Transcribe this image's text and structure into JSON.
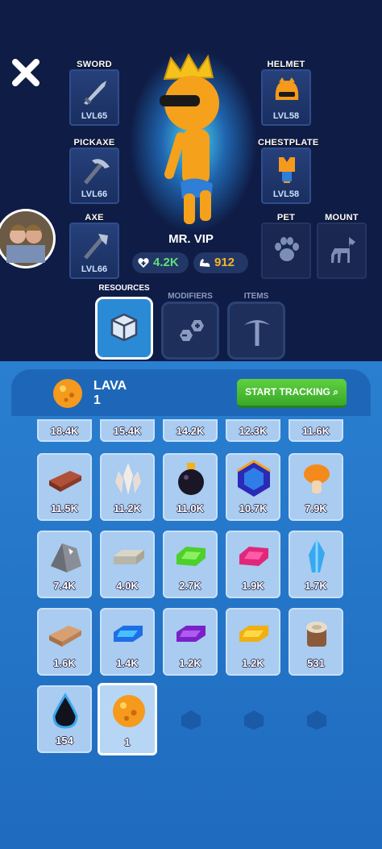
{
  "equipment": {
    "sword": {
      "label": "SWORD",
      "level": "LVL65"
    },
    "pickaxe": {
      "label": "PICKAXE",
      "level": "LVL66"
    },
    "axe": {
      "label": "AXE",
      "level": "LVL66"
    },
    "helmet": {
      "label": "HELMET",
      "level": "LVL58"
    },
    "chestplate": {
      "label": "CHESTPLATE",
      "level": "LVL58"
    },
    "pet": {
      "label": "PET"
    },
    "mount": {
      "label": "MOUNT"
    }
  },
  "character": {
    "name": "MR. VIP",
    "health": "4.2K",
    "strength": "912"
  },
  "tabs": [
    {
      "label": "RESOURCES",
      "active": true
    },
    {
      "label": "MODIFIERS",
      "active": false
    },
    {
      "label": "ITEMS",
      "active": false
    }
  ],
  "selected": {
    "name": "LAVA",
    "count": "1",
    "track_label": "START TRACKING"
  },
  "top_row_amounts": [
    "18.4K",
    "15.4K",
    "14.2K",
    "12.3K",
    "11.6K"
  ],
  "resources": [
    {
      "icon": "brick-icon",
      "amount": "11.5K"
    },
    {
      "icon": "white-crystal-icon",
      "amount": "11.2K"
    },
    {
      "icon": "black-potion-icon",
      "amount": "11.0K"
    },
    {
      "icon": "blue-gem-icon",
      "amount": "10.7K"
    },
    {
      "icon": "orange-mushroom-icon",
      "amount": "7.9K"
    },
    {
      "icon": "stone-icon",
      "amount": "7.4K"
    },
    {
      "icon": "silver-bar-icon",
      "amount": "4.0K"
    },
    {
      "icon": "green-gem-icon",
      "amount": "2.7K"
    },
    {
      "icon": "pink-gem-icon",
      "amount": "1.9K"
    },
    {
      "icon": "ice-crystal-icon",
      "amount": "1.7K"
    },
    {
      "icon": "wood-plank-icon",
      "amount": "1.6K"
    },
    {
      "icon": "blue-bar-icon",
      "amount": "1.4K"
    },
    {
      "icon": "purple-bar-icon",
      "amount": "1.2K"
    },
    {
      "icon": "gold-bar-icon",
      "amount": "1.2K"
    },
    {
      "icon": "stump-icon",
      "amount": "531"
    },
    {
      "icon": "dark-flame-icon",
      "amount": "154"
    },
    {
      "icon": "lava-orb-icon",
      "amount": "1"
    }
  ],
  "colors": {
    "accent_green": "#4cc235",
    "panel_blue": "#2a7fd0",
    "card": "#a9ccf0"
  }
}
